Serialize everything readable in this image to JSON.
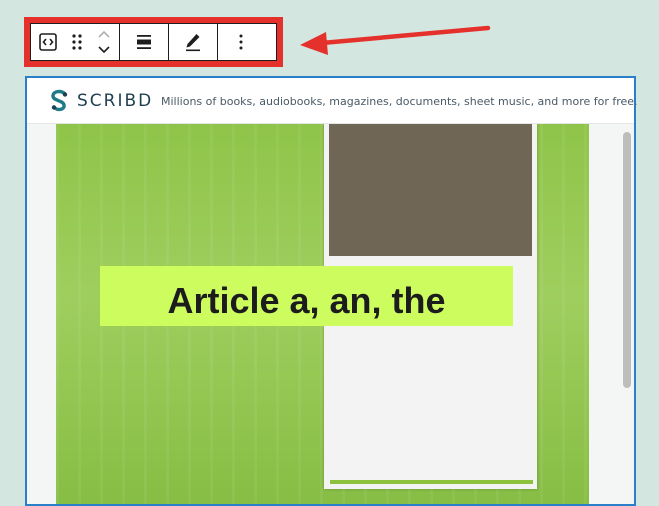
{
  "toolbar": {
    "icons": [
      "embed-block-icon",
      "drag-handle-icon",
      "move-up-icon",
      "move-down-icon",
      "align-icon",
      "edit-pencil-icon",
      "more-options-icon"
    ],
    "highlight_color": "#e5312b"
  },
  "embed": {
    "brand": "SCRIBD",
    "tagline": "Millions of books, audiobooks, magazines, documents, sheet music, and more for free.",
    "border_color": "#2a80c8",
    "slide": {
      "title": "Article a, an, the"
    }
  }
}
